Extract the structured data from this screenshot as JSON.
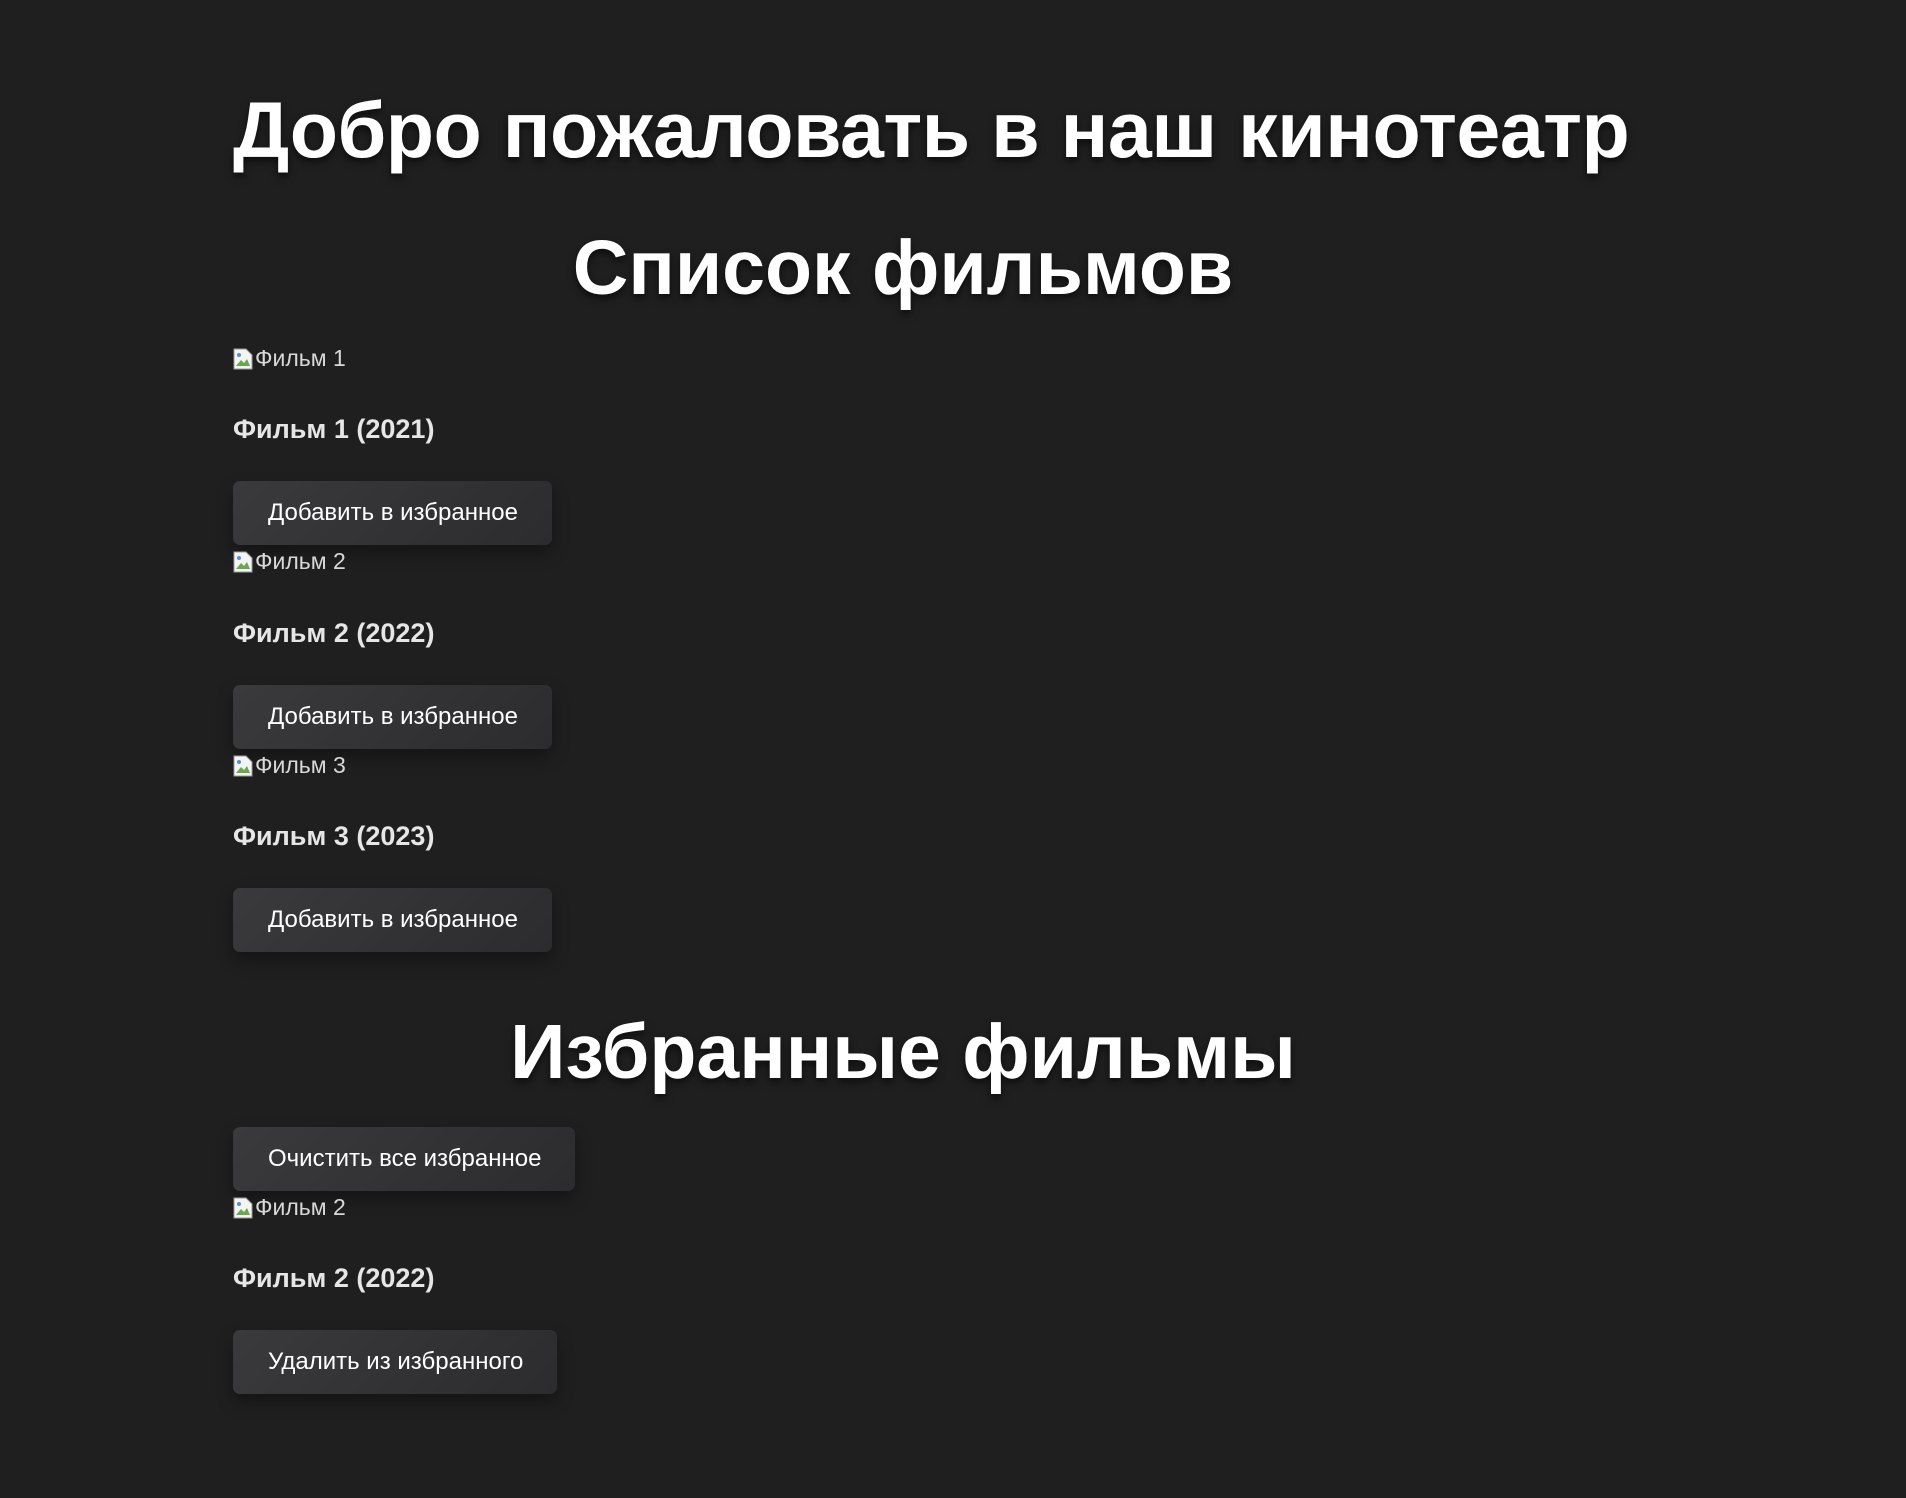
{
  "header": {
    "title": "Добро пожаловать в наш кинотеатр"
  },
  "movie_list": {
    "heading": "Список фильмов",
    "items": [
      {
        "img_alt": "Фильм 1",
        "title": "Фильм 1 (2021)",
        "button_label": "Добавить в избранное"
      },
      {
        "img_alt": "Фильм 2",
        "title": "Фильм 2 (2022)",
        "button_label": "Добавить в избранное"
      },
      {
        "img_alt": "Фильм 3",
        "title": "Фильм 3 (2023)",
        "button_label": "Добавить в избранное"
      }
    ]
  },
  "favorites": {
    "heading": "Избранные фильмы",
    "clear_button_label": "Очистить все избранное",
    "items": [
      {
        "img_alt": "Фильм 2",
        "title": "Фильм 2 (2022)",
        "button_label": "Удалить из избранного"
      }
    ]
  },
  "colors": {
    "background": "#1f1f1f",
    "text": "#ffffff",
    "button_background": "#333335"
  },
  "icons": {
    "broken_image": "broken-image-icon"
  }
}
